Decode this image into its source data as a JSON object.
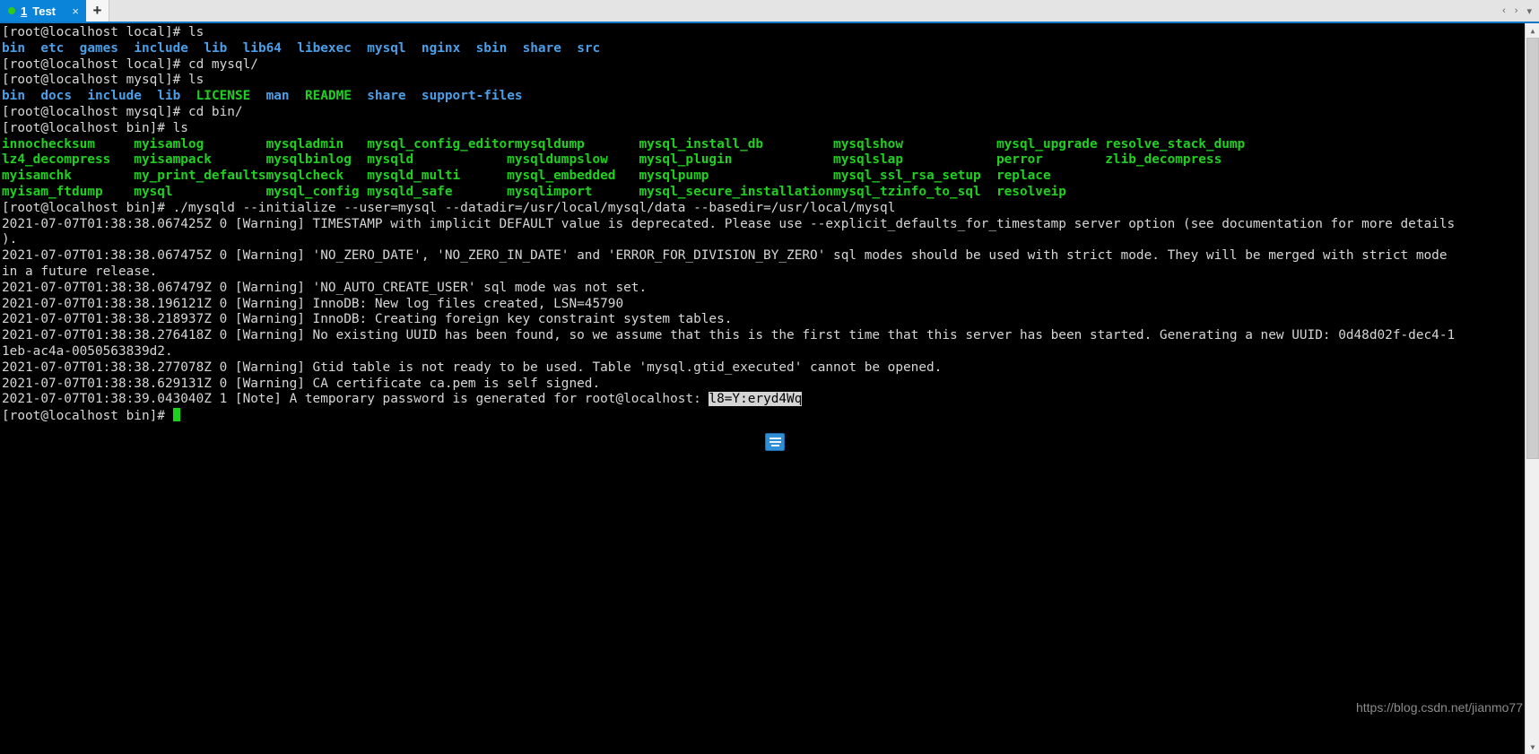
{
  "window": {
    "tab": {
      "number": "1",
      "title": "Test",
      "close_label": "×",
      "status_color": "#2ecc16",
      "active_color": "#0a84d8"
    },
    "new_tab_label": "+",
    "nav_prev": "‹",
    "nav_next": "›",
    "nav_menu": "▾"
  },
  "terminal": {
    "background": "#000000",
    "foreground": "#cfcfcf",
    "dir_color": "#4a9fe8",
    "exec_color": "#20d020",
    "selection_bg": "#d4d4d4",
    "cursor_color": "#1bd21b",
    "prompt_local": "[root@localhost local]#",
    "prompt_mysql": "[root@localhost mysql]#",
    "prompt_bin": "[root@localhost bin]#",
    "lines": [
      {
        "type": "cmd",
        "prompt": "[root@localhost local]# ",
        "cmd": "ls"
      },
      {
        "type": "ls-dirs",
        "items": [
          "bin",
          "etc",
          "games",
          "include",
          "lib",
          "lib64",
          "libexec",
          "mysql",
          "nginx",
          "sbin",
          "share",
          "src"
        ]
      },
      {
        "type": "cmd",
        "prompt": "[root@localhost local]# ",
        "cmd": "cd mysql/"
      },
      {
        "type": "cmd",
        "prompt": "[root@localhost mysql]# ",
        "cmd": "ls"
      },
      {
        "type": "ls-mixed",
        "items": [
          {
            "text": "bin",
            "color": "dir"
          },
          {
            "text": "docs",
            "color": "dir"
          },
          {
            "text": "include",
            "color": "dir"
          },
          {
            "text": "lib",
            "color": "dir"
          },
          {
            "text": "LICENSE",
            "color": "exec"
          },
          {
            "text": "man",
            "color": "dir"
          },
          {
            "text": "README",
            "color": "exec"
          },
          {
            "text": "share",
            "color": "dir"
          },
          {
            "text": "support-files",
            "color": "dir"
          }
        ]
      },
      {
        "type": "cmd",
        "prompt": "[root@localhost mysql]# ",
        "cmd": "cd bin/"
      },
      {
        "type": "cmd",
        "prompt": "[root@localhost bin]# ",
        "cmd": "ls"
      },
      {
        "type": "ls-cols",
        "rows": [
          [
            "innochecksum",
            "myisamlog",
            "mysqladmin",
            "mysql_config_editor",
            "mysqldump",
            "mysql_install_db",
            "mysqlshow",
            "mysql_upgrade",
            "resolve_stack_dump"
          ],
          [
            "lz4_decompress",
            "myisampack",
            "mysqlbinlog",
            "mysqld",
            "mysqldumpslow",
            "mysql_plugin",
            "mysqlslap",
            "perror",
            "zlib_decompress"
          ],
          [
            "myisamchk",
            "my_print_defaults",
            "mysqlcheck",
            "mysqld_multi",
            "mysql_embedded",
            "mysqlpump",
            "mysql_ssl_rsa_setup",
            "replace",
            ""
          ],
          [
            "myisam_ftdump",
            "mysql",
            "mysql_config",
            "mysqld_safe",
            "mysqlimport",
            "mysql_secure_installation",
            "mysql_tzinfo_to_sql",
            "resolveip",
            ""
          ]
        ]
      },
      {
        "type": "cmd",
        "prompt": "[root@localhost bin]# ",
        "cmd": "./mysqld --initialize --user=mysql --datadir=/usr/local/mysql/data --basedir=/usr/local/mysql"
      },
      {
        "type": "log",
        "text": "2021-07-07T01:38:38.067425Z 0 [Warning] TIMESTAMP with implicit DEFAULT value is deprecated. Please use --explicit_defaults_for_timestamp server option (see documentation for more details"
      },
      {
        "type": "log",
        "text": ")."
      },
      {
        "type": "log",
        "text": "2021-07-07T01:38:38.067475Z 0 [Warning] 'NO_ZERO_DATE', 'NO_ZERO_IN_DATE' and 'ERROR_FOR_DIVISION_BY_ZERO' sql modes should be used with strict mode. They will be merged with strict mode"
      },
      {
        "type": "log",
        "text": "in a future release."
      },
      {
        "type": "log",
        "text": "2021-07-07T01:38:38.067479Z 0 [Warning] 'NO_AUTO_CREATE_USER' sql mode was not set."
      },
      {
        "type": "log",
        "text": "2021-07-07T01:38:38.196121Z 0 [Warning] InnoDB: New log files created, LSN=45790"
      },
      {
        "type": "log",
        "text": "2021-07-07T01:38:38.218937Z 0 [Warning] InnoDB: Creating foreign key constraint system tables."
      },
      {
        "type": "log",
        "text": "2021-07-07T01:38:38.276418Z 0 [Warning] No existing UUID has been found, so we assume that this is the first time that this server has been started. Generating a new UUID: 0d48d02f-dec4-1"
      },
      {
        "type": "log",
        "text": "1eb-ac4a-0050563839d2."
      },
      {
        "type": "log",
        "text": "2021-07-07T01:38:38.277078Z 0 [Warning] Gtid table is not ready to be used. Table 'mysql.gtid_executed' cannot be opened."
      },
      {
        "type": "log",
        "text": "2021-07-07T01:38:38.629131Z 0 [Warning] CA certificate ca.pem is self signed."
      },
      {
        "type": "log-sel",
        "prefix": "2021-07-07T01:38:39.043040Z 1 [Note] A temporary password is generated for root@localhost: ",
        "selected": "l8=Y:eryd4Wq"
      },
      {
        "type": "prompt-cursor",
        "prompt": "[root@localhost bin]# "
      }
    ],
    "copy_button": "copy-to-clipboard"
  },
  "watermark": "https://blog.csdn.net/jianmo77",
  "scrollbar": {
    "up_arrow": "▲",
    "down_arrow": "▼"
  }
}
